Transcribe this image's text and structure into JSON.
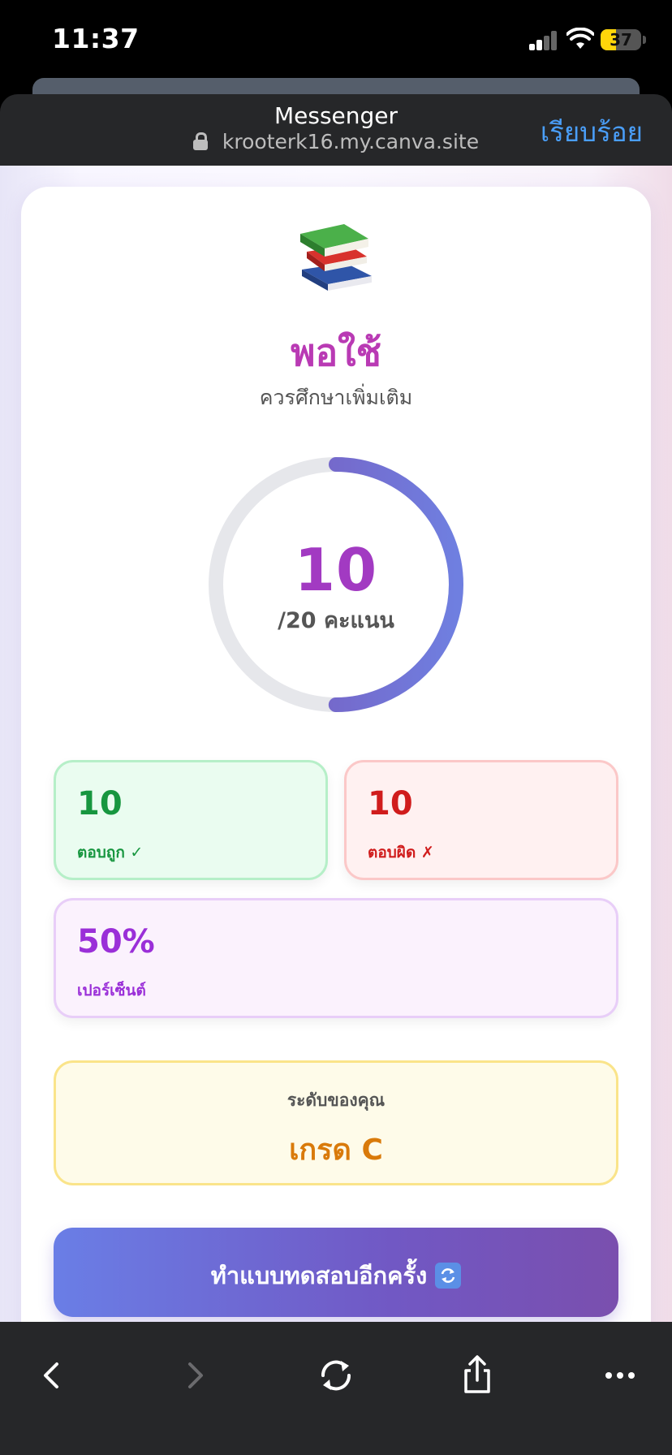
{
  "status_bar": {
    "time": "11:37",
    "battery_level": 37,
    "battery_text": "37"
  },
  "sheet": {
    "title": "Messenger",
    "url": "krooterk16.my.canva.site",
    "done_label": "เรียบร้อย"
  },
  "result": {
    "icon": "books-icon",
    "title": "พอใช้",
    "subtitle": "ควรศึกษาเพิ่มเติม",
    "score": "10",
    "score_total": "/20 คะแนน",
    "progress_fraction": 0.5
  },
  "stats": {
    "correct_value": "10",
    "correct_label": "ตอบถูก ✓",
    "wrong_value": "10",
    "wrong_label": "ตอบผิด ✗",
    "percent_value": "50%",
    "percent_label": "เปอร์เซ็นต์"
  },
  "grade": {
    "label": "ระดับของคุณ",
    "value": "เกรด C"
  },
  "retry": {
    "label": "ทำแบบทดสอบอีกครั้ง",
    "icon": "refresh-icon"
  },
  "colors": {
    "title": "#b93ab4",
    "correct": "#17963f",
    "wrong": "#d01c1c",
    "percent": "#9a2fd8",
    "grade": "#d97a0a",
    "button_start": "#6a7ee6",
    "button_end": "#7a4fae",
    "ring_start": "#7a55b8",
    "ring_end": "#6f7fe0",
    "link": "#4a9ef8"
  },
  "toolbar": {
    "back": "chevron-left-icon",
    "forward": "chevron-right-icon",
    "reload": "reload-icon",
    "share": "share-icon",
    "more": "more-icon"
  }
}
